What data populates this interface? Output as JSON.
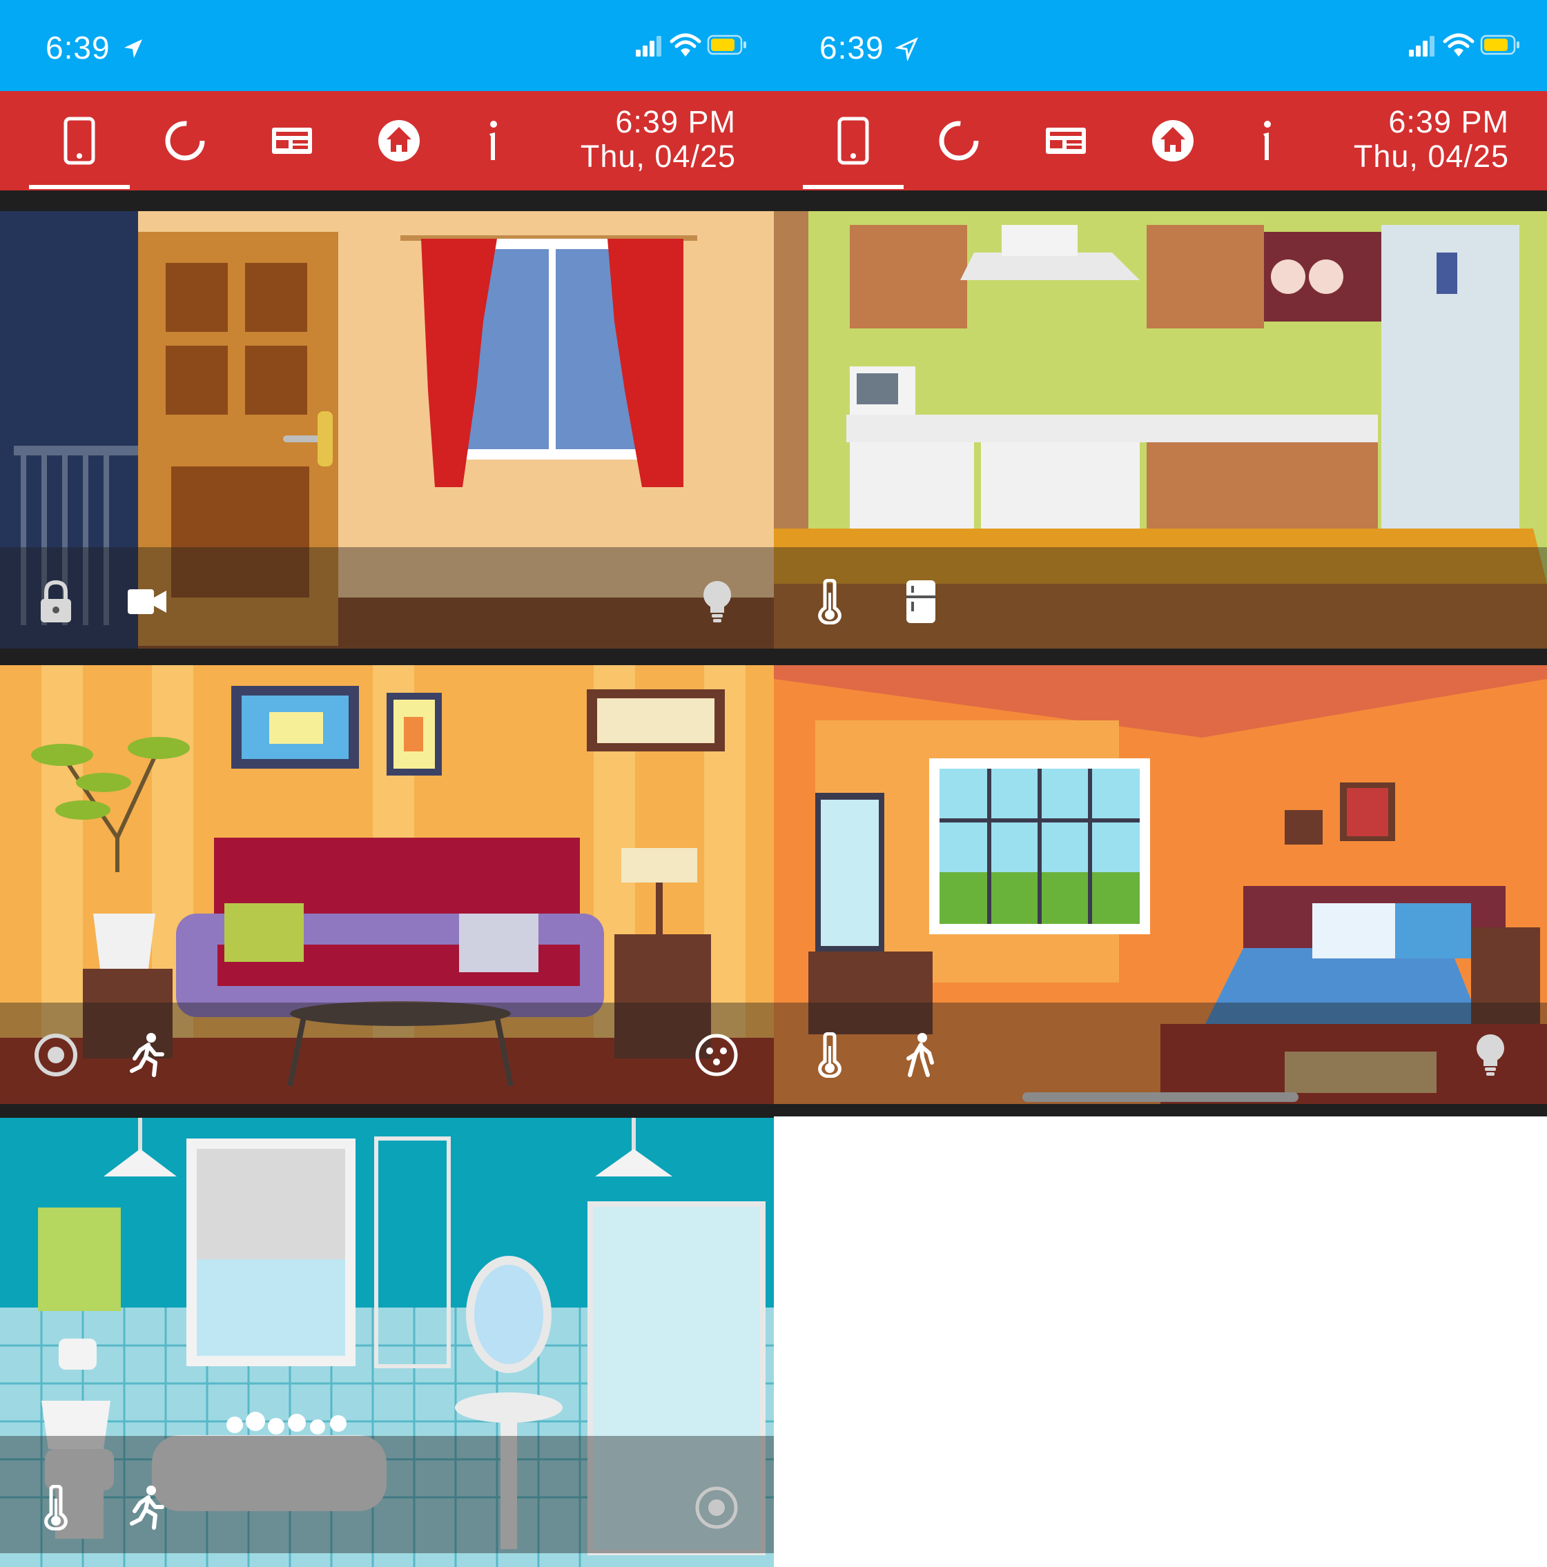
{
  "status_bar": {
    "time": "6:39",
    "icons": [
      "location-arrow-icon",
      "cellular-signal-icon",
      "wifi-icon",
      "battery-icon"
    ]
  },
  "app_bar": {
    "tabs": [
      {
        "name": "device",
        "icon": "smartphone-icon",
        "active": true
      },
      {
        "name": "status",
        "icon": "circular-progress-icon",
        "active": false
      },
      {
        "name": "hardware",
        "icon": "circuit-board-icon",
        "active": false
      },
      {
        "name": "home",
        "icon": "home-icon",
        "active": false
      },
      {
        "name": "info",
        "icon": "info-icon",
        "active": false
      }
    ],
    "clock_time": "6:39 PM",
    "clock_date": "Thu, 04/25"
  },
  "rooms": [
    {
      "name": "entrance",
      "scene": "front-door-with-window-and-red-curtains",
      "controls": [
        "lock-icon",
        "video-camera-icon",
        "lightbulb-icon"
      ]
    },
    {
      "name": "kitchen",
      "scene": "kitchen-with-cabinets-stove-fridge",
      "controls": [
        "thermometer-icon",
        "refrigerator-icon"
      ]
    },
    {
      "name": "living-room",
      "scene": "living-room-with-red-sofa-and-lamp",
      "controls": [
        "speaker-icon",
        "motion-sensor-icon",
        "smart-plug-icon"
      ]
    },
    {
      "name": "bedroom",
      "scene": "bedroom-with-bed-and-large-window",
      "controls": [
        "thermometer-icon",
        "motion-sensor-icon",
        "lightbulb-icon"
      ]
    },
    {
      "name": "bathroom",
      "scene": "bathroom-with-tub-shower-sink",
      "controls": [
        "thermometer-icon",
        "motion-sensor-icon",
        "speaker-icon"
      ]
    }
  ],
  "colors": {
    "status_bar": "#03a9f4",
    "app_bar": "#d32f2f",
    "background": "#ffffff"
  }
}
